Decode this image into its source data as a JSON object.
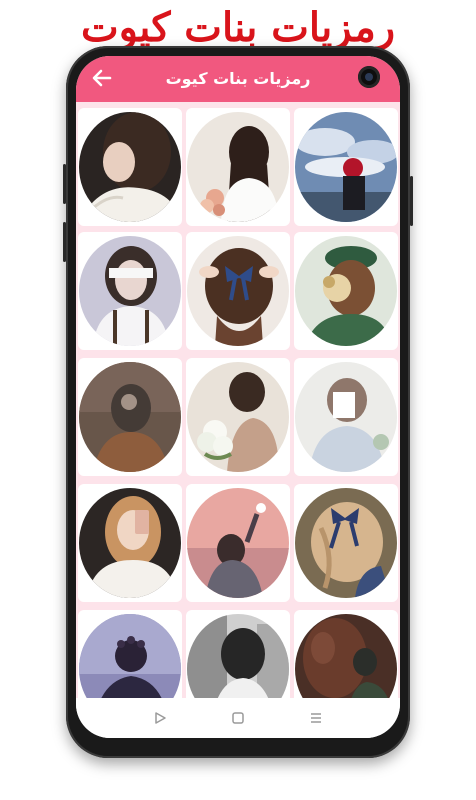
{
  "promo": {
    "title": "رمزيات بنات كيوت"
  },
  "appbar": {
    "title": "رمزيات بنات كيوت",
    "back_icon": "arrow-left-icon",
    "color": "#f1587f"
  },
  "grid": {
    "background": "#fde3ea",
    "images": [
      {
        "subject": "girl-hiding-face-with-hand"
      },
      {
        "subject": "girl-back-with-flowers"
      },
      {
        "subject": "girl-flowers-over-face-sky"
      },
      {
        "subject": "girl-face-covered-with-paper"
      },
      {
        "subject": "girl-back-blue-hair-bow"
      },
      {
        "subject": "girl-green-hat-flowers"
      },
      {
        "subject": "girl-hiding-face-sunset"
      },
      {
        "subject": "girl-holding-white-flowers"
      },
      {
        "subject": "girl-face-covered-faded"
      },
      {
        "subject": "girl-phone-mirror-selfie"
      },
      {
        "subject": "girl-reaching-pink-sky"
      },
      {
        "subject": "girl-curly-hair-bow"
      },
      {
        "subject": "girl-flower-crown-night"
      },
      {
        "subject": "girl-black-and-white-street"
      },
      {
        "subject": "girl-with-horse"
      }
    ]
  },
  "navbar": {
    "buttons": [
      "play-back-icon",
      "home-square-icon",
      "recents-menu-icon"
    ]
  }
}
